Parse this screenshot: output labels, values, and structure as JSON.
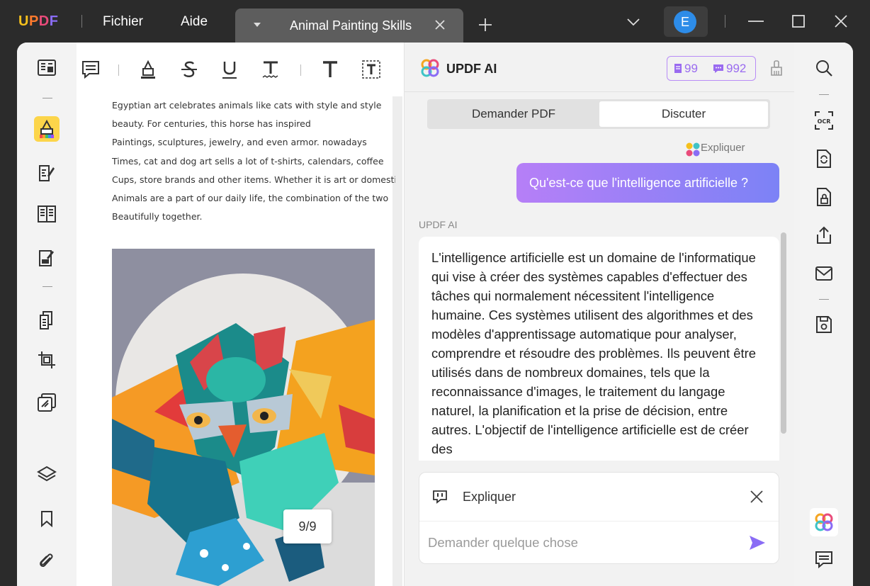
{
  "titlebar": {
    "brand": "UPDF",
    "menu": [
      "Fichier",
      "Aide"
    ],
    "tab_title": "Animal Painting Skills",
    "avatar_letter": "E"
  },
  "doc": {
    "lines": [
      "Egyptian art celebrates animals like cats with style and style",
      "beauty. For centuries, this horse has inspired",
      "Paintings, sculptures, jewelry, and even armor. nowadays",
      "Times, cat and dog art sells a lot of t-shirts, calendars, coffee",
      "Cups, store brands and other items. Whether it is art or domestic",
      "Animals are a part of our daily life, the combination of the two",
      "Beautifully together."
    ],
    "page_indicator": "9/9"
  },
  "ai": {
    "title": "UPDF AI",
    "credits_docs": "99",
    "credits_chat": "992",
    "segments": [
      "Demander PDF",
      "Discuter"
    ],
    "selected_segment": "Discuter",
    "explain_tag": "Expliquer",
    "user_message": "Qu'est-ce que l'intelligence artificielle ?",
    "ai_label": "UPDF AI",
    "ai_response": "L'intelligence artificielle est un domaine de l'informatique qui vise à créer des systèmes capables d'effectuer des tâches qui normalement nécessitent l'intelligence humaine. Ces systèmes utilisent des algorithmes et des modèles d'apprentissage automatique pour analyser, comprendre et résoudre des problèmes. Ils peuvent être utilisés dans de nombreux domaines, tels que la reconnaissance d'images, le traitement du langage naturel, la planification et la prise de décision, entre autres. L'objectif de l'intelligence artificielle est de créer des",
    "context_label": "Expliquer",
    "input_placeholder": "Demander quelque chose"
  },
  "colors": {
    "accent_purple": "#8a6cf5",
    "highlight_yellow": "#fcd54a",
    "titlebar": "#2b2b2b"
  }
}
